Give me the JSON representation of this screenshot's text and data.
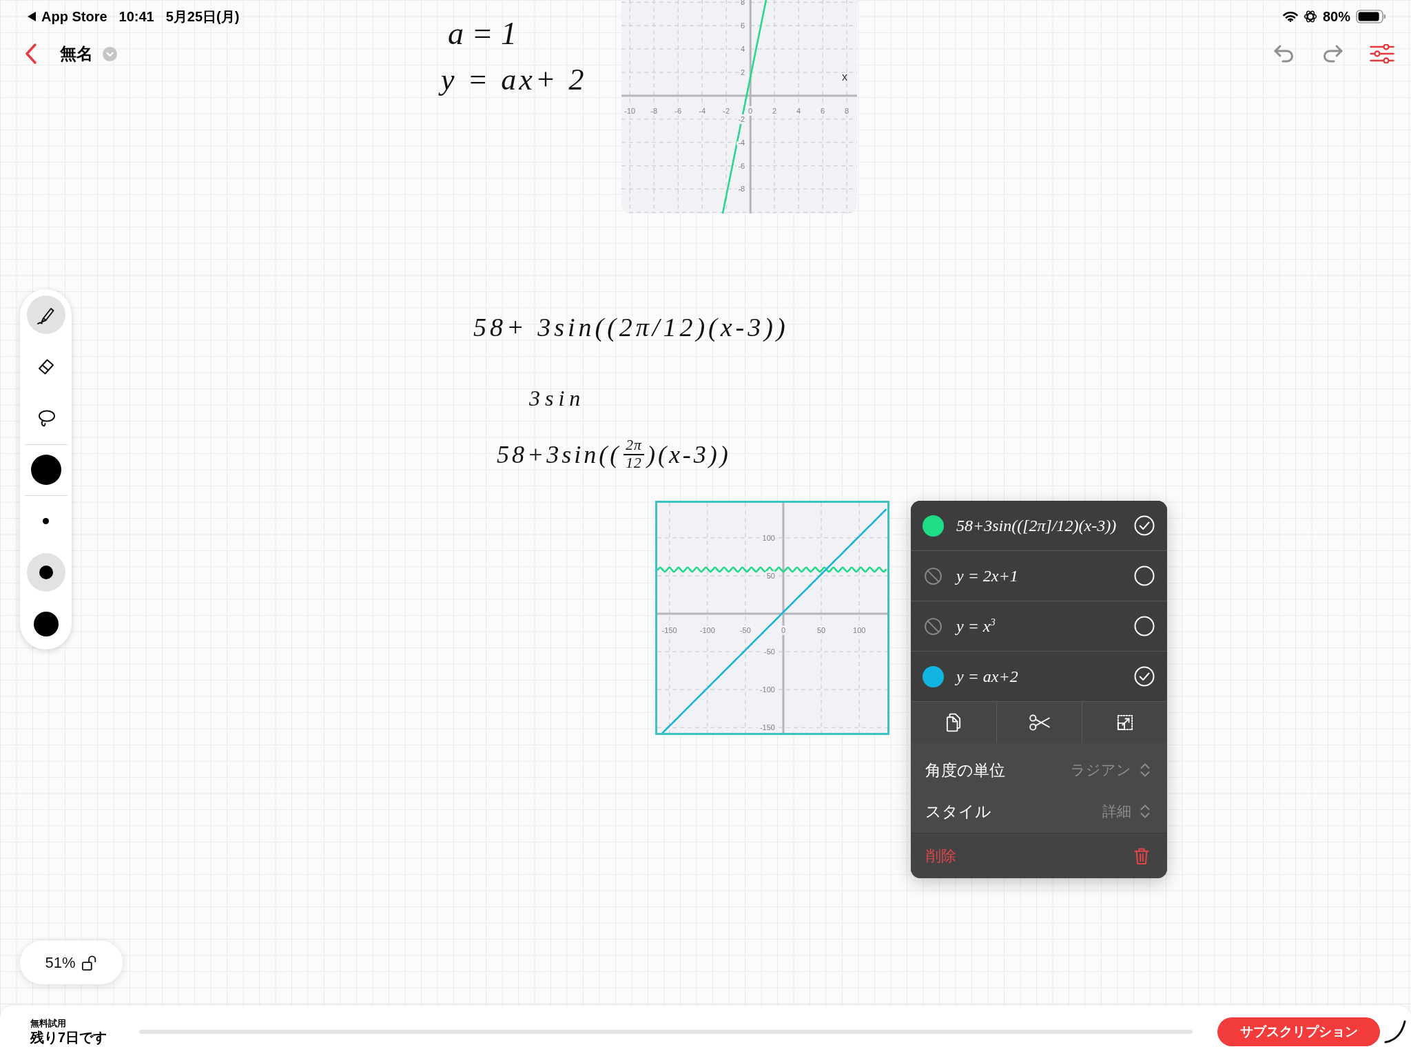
{
  "status_bar": {
    "back_app": "App Store",
    "time": "10:41",
    "date": "5月25日(月)",
    "battery": "80%"
  },
  "title_bar": {
    "title": "無名"
  },
  "canvas": {
    "notes": [
      {
        "kind": "line",
        "text": "a = 1"
      },
      {
        "kind": "line",
        "text": "y = ax+ 2"
      },
      {
        "kind": "line",
        "text": "58+ 3sin((2π/12)(x-3))"
      },
      {
        "kind": "line",
        "text": "3sin"
      },
      {
        "kind": "fraction",
        "before": "58+3sin((",
        "numerator": "2π",
        "denominator": "12",
        "after": ")(x-3))"
      }
    ],
    "graphs": [
      {
        "selected": false,
        "chart_data": {
          "type": "line",
          "xlabel": "x",
          "grid": true,
          "xlim": [
            -10.7,
            8.85
          ],
          "ylim": [
            -10.1,
            8.2
          ],
          "xticks": [
            -10,
            -8,
            -6,
            -4,
            -2,
            0,
            2,
            4,
            6,
            8
          ],
          "yticks": [
            -8,
            -6,
            -4,
            -2,
            2,
            4,
            6,
            8
          ],
          "x": [
            -2.3,
            1.3
          ],
          "series": [
            {
              "color": "#2bd68e",
              "values": [
                -10.1,
                8.2
              ]
            }
          ]
        }
      },
      {
        "selected": true,
        "chart_data": {
          "type": "line",
          "grid": true,
          "xlim": [
            -166,
            137
          ],
          "ylim": [
            -157,
            146
          ],
          "xticks": [
            -150,
            -100,
            -50,
            0,
            50,
            100
          ],
          "yticks": [
            -150,
            -100,
            -50,
            50,
            100
          ],
          "x": [
            -165,
            -162,
            -159,
            -156,
            -153,
            -150,
            -147,
            -144,
            -141,
            -138,
            -135,
            -132,
            -129,
            -126,
            -123,
            -120,
            -117,
            -114,
            -111,
            -108,
            -105,
            -102,
            -99,
            -96,
            -93,
            -90,
            -87,
            -84,
            -81,
            -78,
            -75,
            -72,
            -69,
            -66,
            -63,
            -60,
            -57,
            -54,
            -51,
            -48,
            -45,
            -42,
            -39,
            -36,
            -33,
            -30,
            -27,
            -24,
            -21,
            -18,
            -15,
            -12,
            -9,
            -6,
            -3,
            0,
            3,
            6,
            9,
            12,
            15,
            18,
            21,
            24,
            27,
            30,
            33,
            36,
            39,
            42,
            45,
            48,
            51,
            54,
            57,
            60,
            63,
            66,
            69,
            72,
            75,
            78,
            81,
            84,
            87,
            90,
            93,
            96,
            99,
            102,
            105,
            108,
            111,
            114,
            117,
            120,
            123,
            126,
            129,
            132,
            135
          ],
          "series": [
            {
              "color": "#22d98a",
              "values": [
                58,
                61,
                58,
                55,
                58,
                61,
                58,
                55,
                58,
                61,
                58,
                55,
                58,
                61,
                58,
                55,
                58,
                61,
                58,
                55,
                58,
                61,
                58,
                55,
                58,
                61,
                58,
                55,
                58,
                61,
                58,
                55,
                58,
                61,
                58,
                55,
                58,
                61,
                58,
                55,
                58,
                61,
                58,
                55,
                58,
                61,
                58,
                55,
                58,
                61,
                58,
                55,
                58,
                61,
                58,
                55,
                58,
                61,
                58,
                55,
                58,
                61,
                58,
                55,
                58,
                61,
                58,
                55,
                58,
                61,
                58,
                55,
                58,
                61,
                58,
                55,
                58,
                61,
                58,
                55,
                58,
                61,
                58,
                55,
                58,
                61,
                58,
                55,
                58,
                61,
                58,
                55,
                58,
                61,
                58,
                55,
                58,
                61,
                58,
                55,
                58
              ]
            },
            {
              "color": "#17b3d9",
              "values": [
                null,
                null,
                -157,
                -154,
                -151,
                -148,
                -145,
                -142,
                -139,
                -136,
                -133,
                -130,
                -127,
                -124,
                -121,
                -118,
                -115,
                -112,
                -109,
                -106,
                -103,
                -100,
                -97,
                -94,
                -91,
                -88,
                -85,
                -82,
                -79,
                -76,
                -73,
                -70,
                -67,
                -64,
                -61,
                -58,
                -55,
                -52,
                -49,
                -46,
                -43,
                -40,
                -37,
                -34,
                -31,
                -28,
                -25,
                -22,
                -19,
                -16,
                -13,
                -10,
                -7,
                -4,
                -1,
                2,
                5,
                8,
                11,
                14,
                17,
                20,
                23,
                26,
                29,
                32,
                35,
                38,
                41,
                44,
                47,
                50,
                53,
                56,
                59,
                62,
                65,
                68,
                71,
                74,
                77,
                80,
                83,
                86,
                89,
                92,
                95,
                98,
                101,
                104,
                107,
                110,
                113,
                116,
                119,
                122,
                125,
                128,
                131,
                134,
                137
              ]
            }
          ]
        }
      }
    ]
  },
  "graph_menu": {
    "equations": [
      {
        "expression": "58+3sin(([2π]/12)(x-3))",
        "checked": true,
        "color": "#1fdc86"
      },
      {
        "expression": "y = 2x+1",
        "checked": false
      },
      {
        "expression": "y = x$^{3}$",
        "checked": false
      },
      {
        "expression": "y = ax+2",
        "checked": true,
        "color": "#12b5e0"
      }
    ],
    "settings": [
      {
        "label": "角度の単位",
        "value": "ラジアン"
      },
      {
        "label": "スタイル",
        "value": "詳細"
      }
    ],
    "delete_label": "削除"
  },
  "tool_palette": {
    "tools": [
      {
        "kind": "pen",
        "selected": true
      },
      {
        "kind": "eraser",
        "selected": false
      },
      {
        "kind": "lasso",
        "selected": false
      }
    ],
    "sizes": [
      {
        "kind": "small",
        "selected": false
      },
      {
        "kind": "medium",
        "selected": true
      },
      {
        "kind": "large",
        "selected": false
      }
    ]
  },
  "zoom": {
    "zoom_text": "51%",
    "locked": false
  },
  "trial_banner": {
    "label": "無料試用",
    "remaining": "残り7日です",
    "button": "サブスクリプション"
  }
}
